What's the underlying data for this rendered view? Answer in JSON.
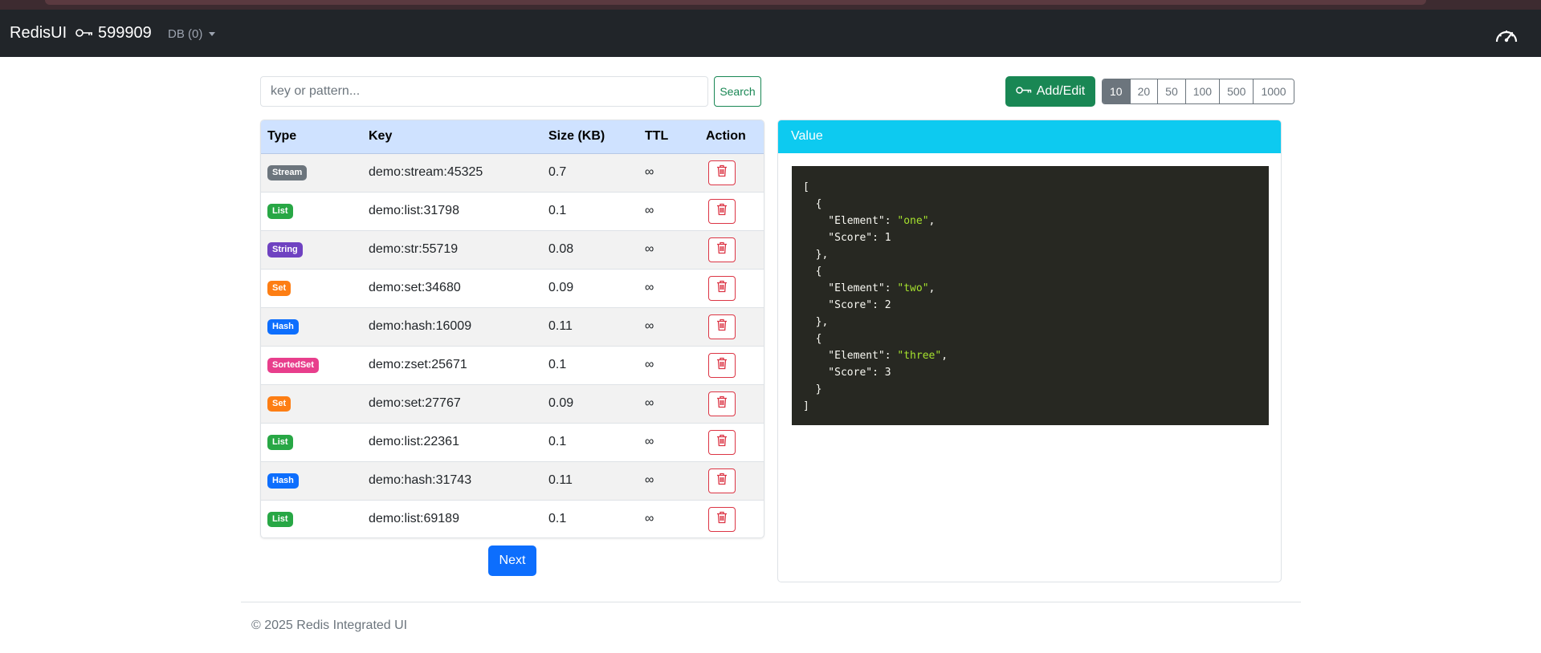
{
  "navbar": {
    "brand": "RedisUI",
    "key_count": "599909",
    "db_selector": "DB (0)",
    "key_icon": "key-icon",
    "dashboard_icon": "speedometer-icon"
  },
  "search": {
    "placeholder": "key or pattern...",
    "value": "",
    "button_label": "Search"
  },
  "toolbar": {
    "add_edit_label": "Add/Edit",
    "page_sizes": [
      "10",
      "20",
      "50",
      "100",
      "500",
      "1000"
    ],
    "active_page_size": "10"
  },
  "table": {
    "headers": {
      "type": "Type",
      "key": "Key",
      "size": "Size (KB)",
      "ttl": "TTL",
      "action": "Action"
    },
    "rows": [
      {
        "type": "Stream",
        "color": "#6c757d",
        "key": "demo:stream:45325",
        "size": "0.7",
        "ttl": "∞"
      },
      {
        "type": "List",
        "color": "#28a745",
        "key": "demo:list:31798",
        "size": "0.1",
        "ttl": "∞"
      },
      {
        "type": "String",
        "color": "#6f42c1",
        "key": "demo:str:55719",
        "size": "0.08",
        "ttl": "∞"
      },
      {
        "type": "Set",
        "color": "#fd7e14",
        "key": "demo:set:34680",
        "size": "0.09",
        "ttl": "∞"
      },
      {
        "type": "Hash",
        "color": "#0d6efd",
        "key": "demo:hash:16009",
        "size": "0.11",
        "ttl": "∞"
      },
      {
        "type": "SortedSet",
        "color": "#e83e8c",
        "key": "demo:zset:25671",
        "size": "0.1",
        "ttl": "∞"
      },
      {
        "type": "Set",
        "color": "#fd7e14",
        "key": "demo:set:27767",
        "size": "0.09",
        "ttl": "∞"
      },
      {
        "type": "List",
        "color": "#28a745",
        "key": "demo:list:22361",
        "size": "0.1",
        "ttl": "∞"
      },
      {
        "type": "Hash",
        "color": "#0d6efd",
        "key": "demo:hash:31743",
        "size": "0.11",
        "ttl": "∞"
      },
      {
        "type": "List",
        "color": "#28a745",
        "key": "demo:list:69189",
        "size": "0.1",
        "ttl": "∞"
      }
    ],
    "delete_icon": "trash-icon"
  },
  "pagination": {
    "next_label": "Next"
  },
  "value_panel": {
    "title": "Value",
    "json_lines": [
      [
        {
          "t": "["
        }
      ],
      [
        {
          "t": "  {"
        }
      ],
      [
        {
          "t": "    \"Element\": "
        },
        {
          "t": "\"one\"",
          "c": "str"
        },
        {
          "t": ","
        }
      ],
      [
        {
          "t": "    \"Score\": "
        },
        {
          "t": "1",
          "c": "num"
        }
      ],
      [
        {
          "t": "  },"
        }
      ],
      [
        {
          "t": "  {"
        }
      ],
      [
        {
          "t": "    \"Element\": "
        },
        {
          "t": "\"two\"",
          "c": "str"
        },
        {
          "t": ","
        }
      ],
      [
        {
          "t": "    \"Score\": "
        },
        {
          "t": "2",
          "c": "num"
        }
      ],
      [
        {
          "t": "  },"
        }
      ],
      [
        {
          "t": "  {"
        }
      ],
      [
        {
          "t": "    \"Element\": "
        },
        {
          "t": "\"three\"",
          "c": "str"
        },
        {
          "t": ","
        }
      ],
      [
        {
          "t": "    \"Score\": "
        },
        {
          "t": "3",
          "c": "num"
        }
      ],
      [
        {
          "t": "  }"
        }
      ],
      [
        {
          "t": "]"
        }
      ]
    ]
  },
  "footer": {
    "text": "© 2025 Redis Integrated UI"
  },
  "colors": {
    "navbar": "#212529",
    "success": "#198754",
    "primary": "#0d6efd",
    "info": "#0dcaf0",
    "danger": "#dc3545"
  }
}
